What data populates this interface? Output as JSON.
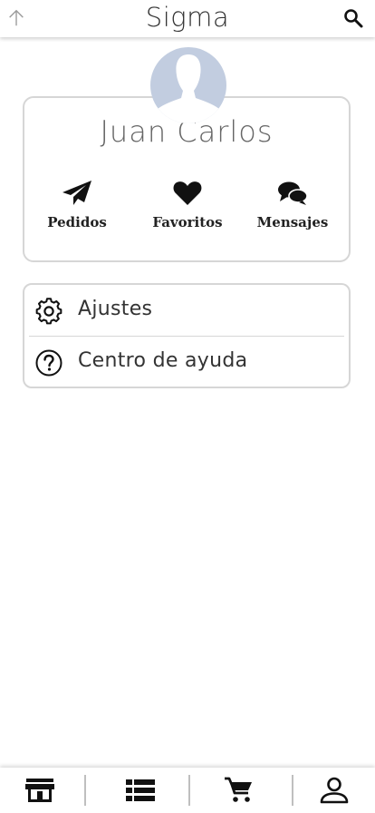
{
  "header": {
    "title": "Sigma",
    "back_icon": "arrow-up-icon",
    "search_icon": "search-icon"
  },
  "profile": {
    "name": "Juan Carlos",
    "avatar_color": "#c2cde0",
    "actions": [
      {
        "label": "Pedidos",
        "icon": "paper-plane-icon"
      },
      {
        "label": "Favoritos",
        "icon": "heart-icon"
      },
      {
        "label": "Mensajes",
        "icon": "chat-bubbles-icon"
      }
    ]
  },
  "menu": {
    "items": [
      {
        "label": "Ajustes",
        "icon": "gear-icon"
      },
      {
        "label": "Centro de ayuda",
        "icon": "help-circle-icon"
      }
    ]
  },
  "bottom_nav": {
    "tabs": [
      {
        "icon": "store-icon"
      },
      {
        "icon": "list-icon"
      },
      {
        "icon": "cart-icon"
      },
      {
        "icon": "user-icon"
      }
    ]
  }
}
